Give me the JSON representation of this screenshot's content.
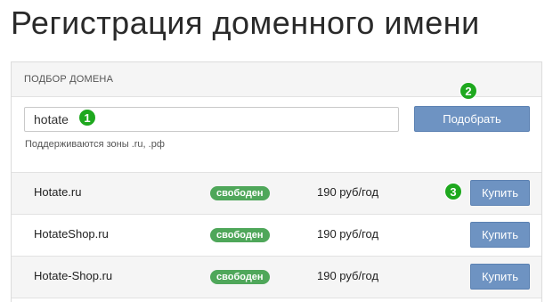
{
  "page": {
    "title": "Регистрация доменного имени"
  },
  "panel": {
    "header": "ПОДБОР ДОМЕНА",
    "search": {
      "value": "hotate",
      "hint": "Поддерживаются зоны .ru, .рф",
      "button_label": "Подобрать"
    }
  },
  "results": [
    {
      "domain": "Hotate.ru",
      "status": "свободен",
      "price": "190 руб/год",
      "buy_label": "Купить"
    },
    {
      "domain": "HotateShop.ru",
      "status": "свободен",
      "price": "190 руб/год",
      "buy_label": "Купить"
    },
    {
      "domain": "Hotate-Shop.ru",
      "status": "свободен",
      "price": "190 руб/год",
      "buy_label": "Купить"
    }
  ],
  "markers": [
    "1",
    "2",
    "3"
  ],
  "colors": {
    "button": "#6e93c2",
    "status_badge": "#4fa75a",
    "marker": "#1ea81e"
  }
}
